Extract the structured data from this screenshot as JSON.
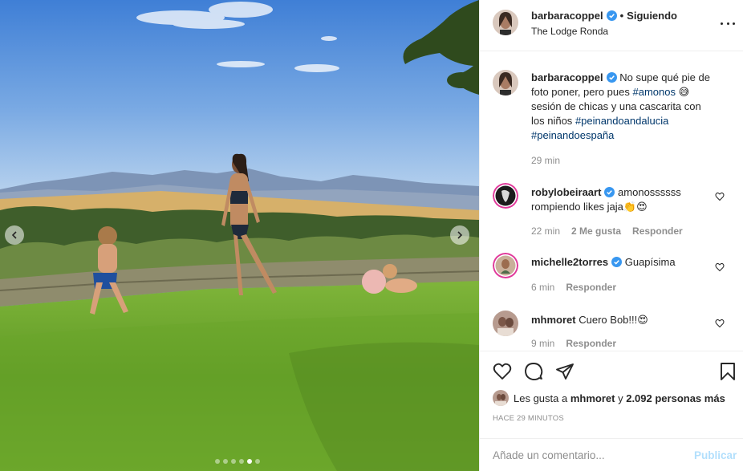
{
  "post": {
    "username": "barbaracoppel",
    "separator": "•",
    "follow_status": "Siguiendo",
    "location": "The Lodge Ronda",
    "caption": {
      "username": "barbaracoppel",
      "text_before": "No supe qué pie de foto poner, pero pues",
      "hashtag1": "#amonos",
      "emoji1": "😅",
      "text_after": "sesión de chicas y una cascarita con los niños",
      "hashtag2": "#peinandoandalucia",
      "hashtag3": "#peinandoespaña",
      "time": "29 min"
    }
  },
  "comments": [
    {
      "username": "robylobeiraart",
      "verified": true,
      "text": "amonossssss rompiendo likes jaja👏😍",
      "time": "22 min",
      "likes": "2 Me gusta",
      "reply": "Responder"
    },
    {
      "username": "michelle2torres",
      "verified": true,
      "text": "Guapísima",
      "time": "6 min",
      "reply": "Responder"
    },
    {
      "username": "mhmoret",
      "verified": false,
      "text": "Cuero Bob!!!😍",
      "time": "9 min",
      "reply": "Responder"
    }
  ],
  "likes": {
    "prefix": "Les gusta a",
    "user": "mhmoret",
    "connector": "y",
    "others": "2.092 personas más"
  },
  "time_ago": "HACE 29 MINUTOS",
  "comment_box": {
    "placeholder": "Añade un comentario...",
    "publish_label": "Publicar"
  },
  "carousel": {
    "count": 6,
    "active_index": 4
  },
  "icons": {
    "more": "more-options-icon",
    "like": "heart-icon",
    "comment": "comment-icon",
    "share": "share-icon",
    "save": "bookmark-icon",
    "prev": "chevron-left-icon",
    "next": "chevron-right-icon",
    "verified": "verified-badge-icon"
  },
  "colors": {
    "link": "#00376b",
    "verified": "#3897f0",
    "muted": "#8e8e8e",
    "publish_disabled": "#b2dffc",
    "text": "#262626",
    "divider": "#efefef"
  }
}
